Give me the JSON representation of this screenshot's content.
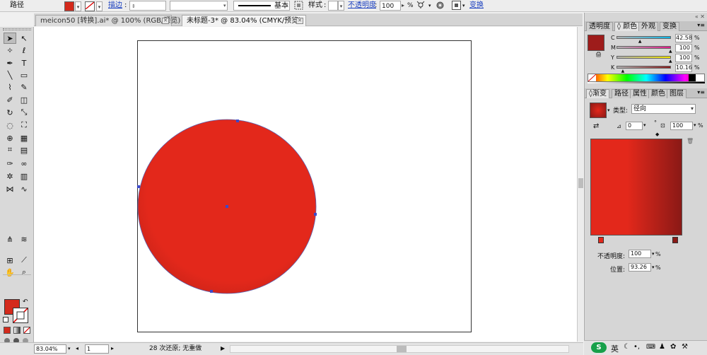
{
  "control_bar": {
    "object_type": "路径",
    "fill_color": "#d42a1c",
    "stroke_label": "描边",
    "stroke_style": "基本",
    "style_label": "样式",
    "opacity_label": "不透明度",
    "opacity_value": "100",
    "opacity_unit": "%",
    "transform_label": "变换"
  },
  "document_tabs": [
    {
      "label": "meicon50 [转换].ai* @ 100% (RGB/预览)",
      "active": false
    },
    {
      "label": "未标题-3* @ 83.04% (CMYK/预览)",
      "active": true
    }
  ],
  "tools": [
    "selection-tool",
    "direct-selection-tool",
    "magic-wand-tool",
    "lasso-tool",
    "pen-tool",
    "type-tool",
    "line-tool",
    "rectangle-tool",
    "paintbrush-tool",
    "pencil-tool",
    "blob-brush-tool",
    "eraser-tool",
    "rotate-tool",
    "scale-tool",
    "warp-tool",
    "free-transform-tool",
    "shape-builder-tool",
    "perspective-grid-tool",
    "mesh-tool",
    "gradient-tool",
    "eyedropper-tool",
    "blend-tool",
    "symbol-sprayer-tool",
    "graph-tool",
    "width-tool",
    "reshape-tool",
    "join-tool",
    "smooth-tool",
    "artboard-tool",
    "slice-tool",
    "hand-tool",
    "zoom-tool"
  ],
  "swatch_colors": {
    "fill": "#d42a1c",
    "stroke": "none"
  },
  "artwork": {
    "gradient_type": "radial",
    "dark_color": "#8a1916",
    "light_color": "#e3281b"
  },
  "status_bar": {
    "zoom": "83.04%",
    "artboard_number": "1",
    "status_text": "28 次还原; 无重做"
  },
  "color_panel": {
    "tabs": [
      "透明度",
      "颜色",
      "外观",
      "变换"
    ],
    "active_tab": "颜色",
    "current_color": "#9e1c1b",
    "channels": [
      {
        "label": "C",
        "value": "42.58",
        "fraction": 0.4258,
        "track": "#0fb6e6"
      },
      {
        "label": "M",
        "value": "100",
        "fraction": 1.0,
        "track": "#e01d8a"
      },
      {
        "label": "Y",
        "value": "100",
        "fraction": 1.0,
        "track": "#f2e600"
      },
      {
        "label": "K",
        "value": "10.16",
        "fraction": 0.1016,
        "track": "#8a1b1b"
      }
    ],
    "unit": "%"
  },
  "gradient_panel": {
    "tabs": [
      "渐变",
      "路径",
      "属性",
      "颜色",
      "图层"
    ],
    "active_tab": "渐变",
    "type_label": "类型:",
    "type_value": "径向",
    "angle_value": "0",
    "angle_unit": "°",
    "aspect_value": "100",
    "aspect_unit": "%",
    "preview_start": "#e3281b",
    "preview_end": "#8a1916",
    "opacity_label": "不透明度:",
    "opacity_value": "100",
    "location_label": "位置:",
    "location_value": "93.26",
    "unit": "%"
  },
  "taskbar": {
    "ime_label": "英"
  }
}
